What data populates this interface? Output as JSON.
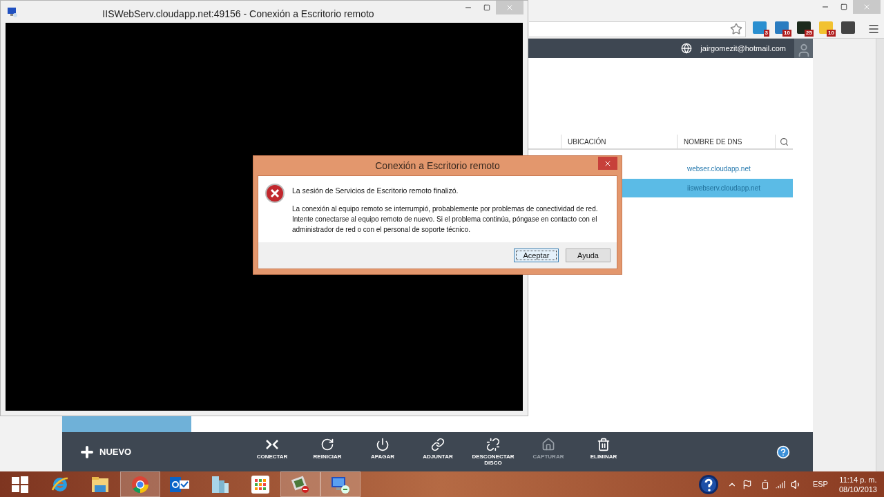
{
  "browser": {
    "extensions": [
      {
        "kind": "g",
        "badge": "3"
      },
      {
        "kind": "b",
        "badge": "10"
      },
      {
        "kind": "w",
        "badge": "25"
      },
      {
        "kind": "fire",
        "badge": "10"
      },
      {
        "kind": "elephant"
      }
    ],
    "account": "jairgomezit@hotmail.com",
    "table": {
      "columns": [
        "UBICACIÓN",
        "NOMBRE DE DNS"
      ],
      "rows": [
        {
          "dns": "webser.cloudapp.net",
          "selected": false
        },
        {
          "dns": "iiswebserv.cloudapp.net",
          "selected": true
        }
      ]
    },
    "new_button": "NUEVO",
    "commands": [
      {
        "kind": "connect",
        "label": "CONECTAR",
        "disabled": false
      },
      {
        "kind": "restart",
        "label": "REINICIAR",
        "disabled": false
      },
      {
        "kind": "power",
        "label": "APAGAR",
        "disabled": false
      },
      {
        "kind": "attach",
        "label": "ADJUNTAR",
        "disabled": false
      },
      {
        "kind": "detach",
        "label": "DESCONECTAR DISCO",
        "disabled": false
      },
      {
        "kind": "capture",
        "label": "CAPTURAR",
        "disabled": true
      },
      {
        "kind": "delete",
        "label": "ELIMINAR",
        "disabled": false
      }
    ]
  },
  "remote_window": {
    "title": "IISWebServ.cloudapp.net:49156 - Conexión a Escritorio remoto"
  },
  "dialog": {
    "title": "Conexión a Escritorio remoto",
    "heading": "La sesión de Servicios de Escritorio remoto finalizó.",
    "message": "La conexión al equipo remoto se interrumpió, probablemente por problemas de conectividad de red. Intente conectarse al equipo remoto de nuevo. Si el problema continúa, póngase en contacto con el administrador de red o con el personal de soporte técnico.",
    "buttons": [
      {
        "label": "Aceptar",
        "focused": true
      },
      {
        "label": "Ayuda",
        "focused": false
      }
    ]
  },
  "taskbar": {
    "apps": [
      {
        "kind": "start",
        "active": false
      },
      {
        "kind": "ie",
        "active": false
      },
      {
        "kind": "folder",
        "active": false
      },
      {
        "kind": "chrome",
        "active": true
      },
      {
        "kind": "outlook",
        "active": false
      },
      {
        "kind": "servers",
        "active": false
      },
      {
        "kind": "apps",
        "active": false
      },
      {
        "kind": "photo",
        "active": true
      },
      {
        "kind": "remote",
        "active": true
      }
    ],
    "language": "ESP",
    "time": "11:14 p. m.",
    "date": "08/10/2013"
  }
}
